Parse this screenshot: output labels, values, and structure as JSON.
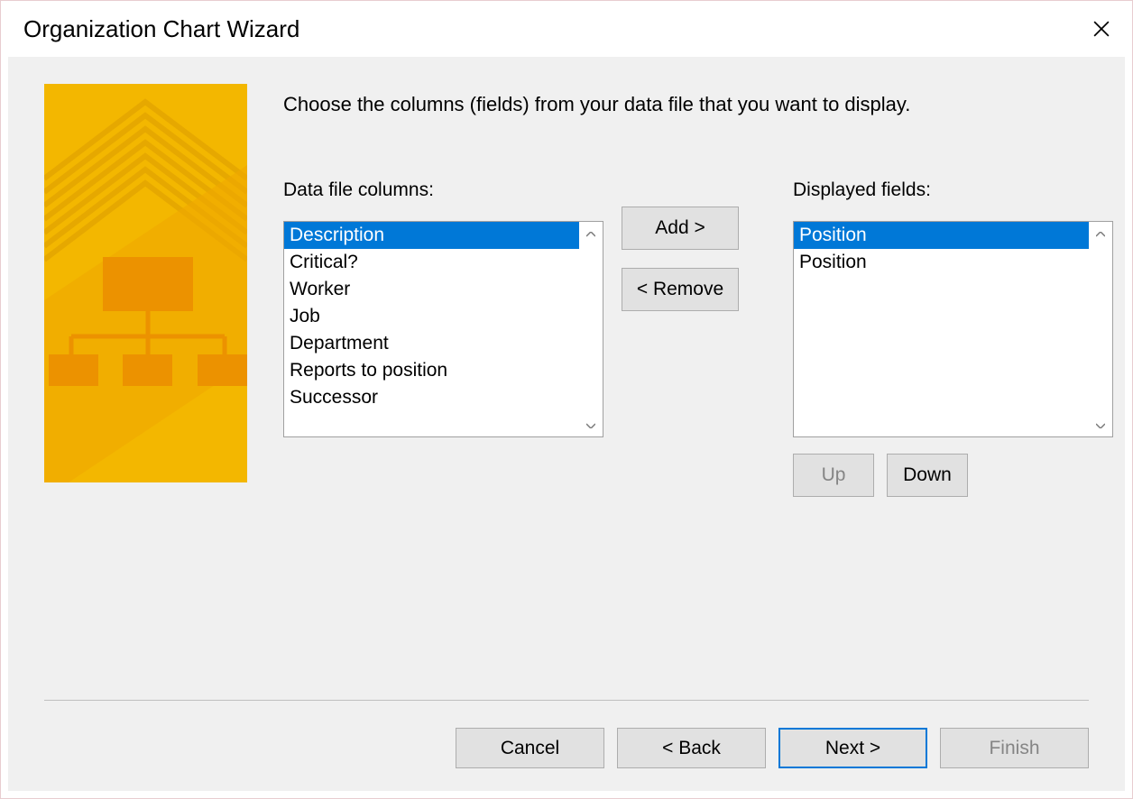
{
  "window": {
    "title": "Organization Chart Wizard"
  },
  "instruction": "Choose the columns (fields) from your data file that you want to display.",
  "labels": {
    "available": "Data file columns:",
    "displayed": "Displayed fields:"
  },
  "available_columns": {
    "items": [
      "Description",
      "Critical?",
      "Worker",
      "Job",
      "Department",
      "Reports to position",
      "Successor"
    ],
    "selected_index": 0
  },
  "displayed_fields": {
    "items": [
      "Position",
      "Position"
    ],
    "selected_index": 0
  },
  "buttons": {
    "add": "Add >",
    "remove": "< Remove",
    "up": "Up",
    "down": "Down",
    "cancel": "Cancel",
    "back": "< Back",
    "next": "Next >",
    "finish": "Finish"
  }
}
